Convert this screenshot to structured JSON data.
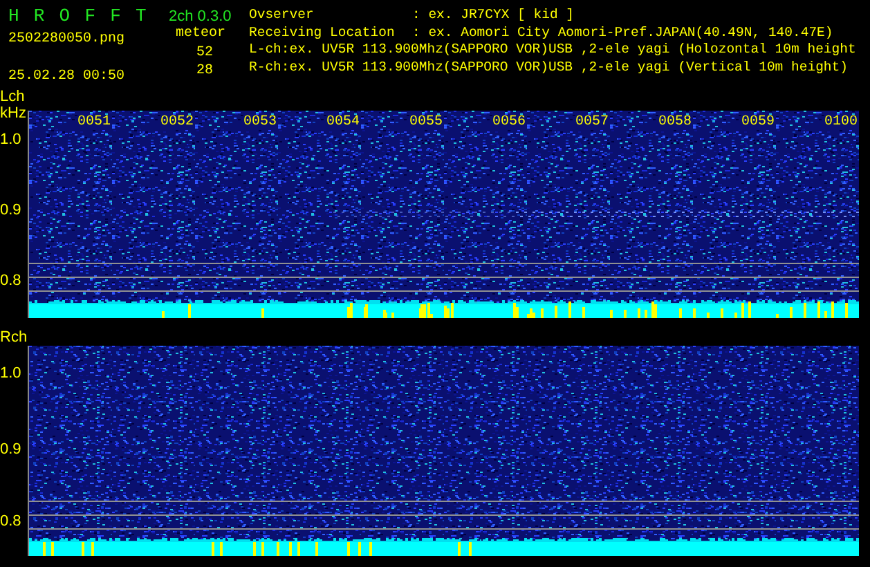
{
  "app": {
    "title": "H R O F F T",
    "version": "2ch 0.3.0"
  },
  "file": {
    "name": "2502280050.png",
    "datetime": "25.02.28 00:50"
  },
  "meteor": {
    "label": "meteor",
    "counts": [
      "52",
      "28"
    ]
  },
  "info": [
    {
      "kind": "field",
      "label": "Ovserver",
      "value": ": ex. JR7CYX [ kid ]"
    },
    {
      "kind": "field",
      "label": "Receiving Location",
      "value": ": ex. Aomori City Aomori-Pref.JAPAN(40.49N, 140.47E)"
    },
    {
      "kind": "line",
      "text": "L-ch:ex. UV5R 113.900Mhz(SAPPORO VOR)USB ,2-ele yagi (Holozontal 10m height"
    },
    {
      "kind": "line",
      "text": "R-ch:ex. UV5R 113.900Mhz(SAPPORO VOR)USB ,2-ele yagi (Vertical 10m height)"
    }
  ],
  "panels": [
    {
      "channel": "Lch",
      "unit": "kHz",
      "y_labels": [
        "1.0",
        "0.9",
        "0.8"
      ],
      "time_labels": [
        "0051",
        "0052",
        "0053",
        "0054",
        "0055",
        "0056",
        "0057",
        "0058",
        "0059",
        "0100"
      ]
    },
    {
      "channel": "Rch",
      "y_labels": [
        "1.0",
        "0.9",
        "0.8"
      ]
    }
  ]
}
